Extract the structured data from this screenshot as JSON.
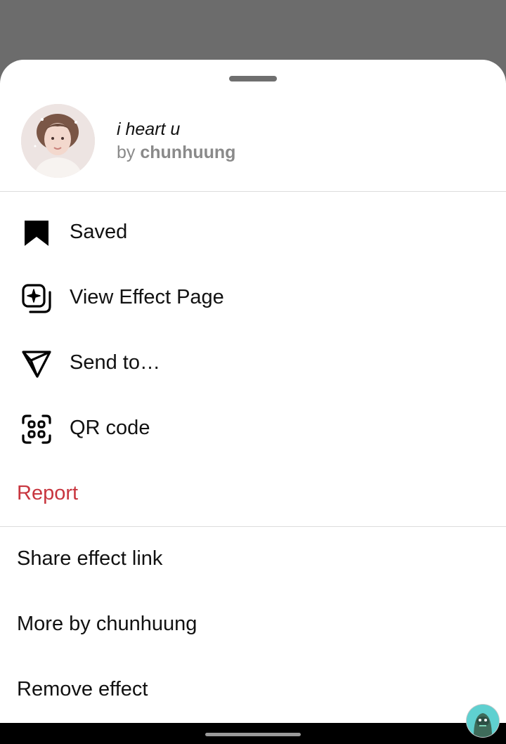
{
  "effect": {
    "title": "i heart u",
    "by_prefix": "by",
    "author": "chunhuung"
  },
  "menu": {
    "saved": {
      "label": "Saved",
      "icon": "bookmark-filled-icon"
    },
    "view_effect_page": {
      "label": "View Effect Page",
      "icon": "effect-page-icon"
    },
    "send_to": {
      "label": "Send to…",
      "icon": "send-icon"
    },
    "qr_code": {
      "label": "QR code",
      "icon": "qr-code-icon"
    },
    "report": {
      "label": "Report",
      "color": "#c8363f"
    }
  },
  "secondary": {
    "share_link": "Share effect link",
    "more_by": "More by chunhuung",
    "remove": "Remove effect"
  },
  "colors": {
    "sheet": "#ffffff",
    "backdrop": "#6b6b6b",
    "danger": "#c8363f",
    "muted_text": "#8a8a8a"
  }
}
